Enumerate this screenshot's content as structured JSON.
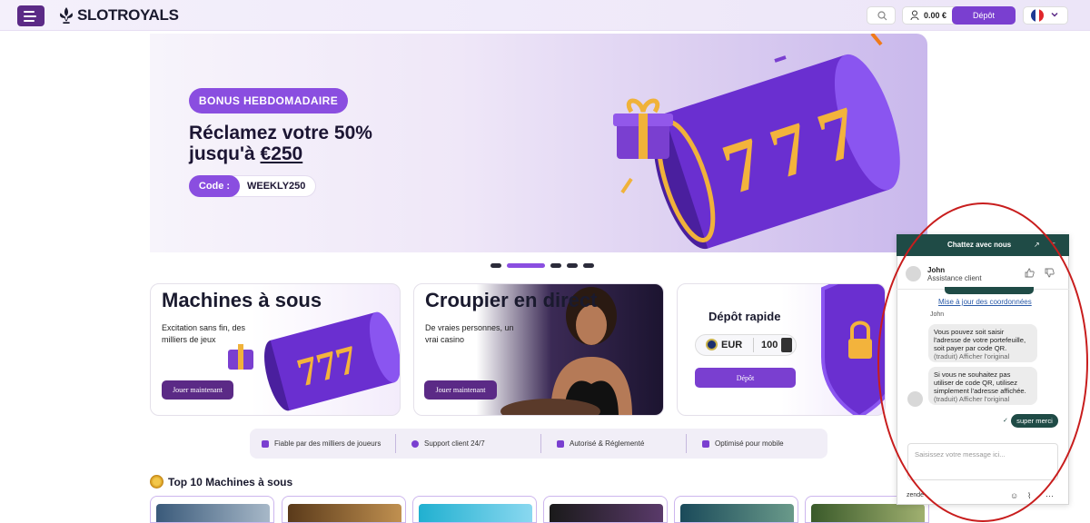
{
  "header": {
    "logo_text": "SLOTROYALS",
    "balance": "0.00 €",
    "deposit_label": "Dépôt"
  },
  "hero": {
    "badge": "BONUS HEBDOMADAIRE",
    "line1": "Réclamez votre 50%",
    "line2_prefix": "jusqu'à ",
    "line2_amount": "€250",
    "code_label": "Code :",
    "code_value": "WEEKLY250",
    "slides_total": 5,
    "active_slide": 2
  },
  "cards": [
    {
      "title": "Machines à sous",
      "desc": "Excitation sans fin, des milliers de jeux",
      "button": "Jouer maintenant"
    },
    {
      "title": "Croupier en direct",
      "desc": "De vraies personnes, un vrai casino",
      "button": "Jouer maintenant"
    }
  ],
  "fast_deposit": {
    "title": "Dépôt rapide",
    "currency": "EUR",
    "amount": "100",
    "button": "Dépôt"
  },
  "features": [
    "Fiable par des milliers de joueurs",
    "Support client 24/7",
    "Autorisé & Réglementé",
    "Optimisé pour mobile"
  ],
  "top10": {
    "title": "Top 10 Machines à sous"
  },
  "chat": {
    "title": "Chattez avec nous",
    "agent_name": "John",
    "agent_role": "Assistance client",
    "link": "Mise à jour des coordonnées",
    "sender": "John",
    "msg1": "Vous pouvez soit saisir l'adresse de votre portefeuille, soit payer par code QR.",
    "msg2": "Si vous ne souhaitez pas utiliser de code QR, utilisez simplement l'adresse affichée.",
    "translated": "(traduit)",
    "show_original": "Afficher l'original",
    "my_msg": "super merci",
    "input_placeholder": "Saisissez votre message ici...",
    "footer": "zende"
  },
  "colors": {
    "accent": "#8a4ee0",
    "brand_dark": "#5b2a86",
    "chat_header": "#1f4b46",
    "highlight": "#c81d1d"
  }
}
